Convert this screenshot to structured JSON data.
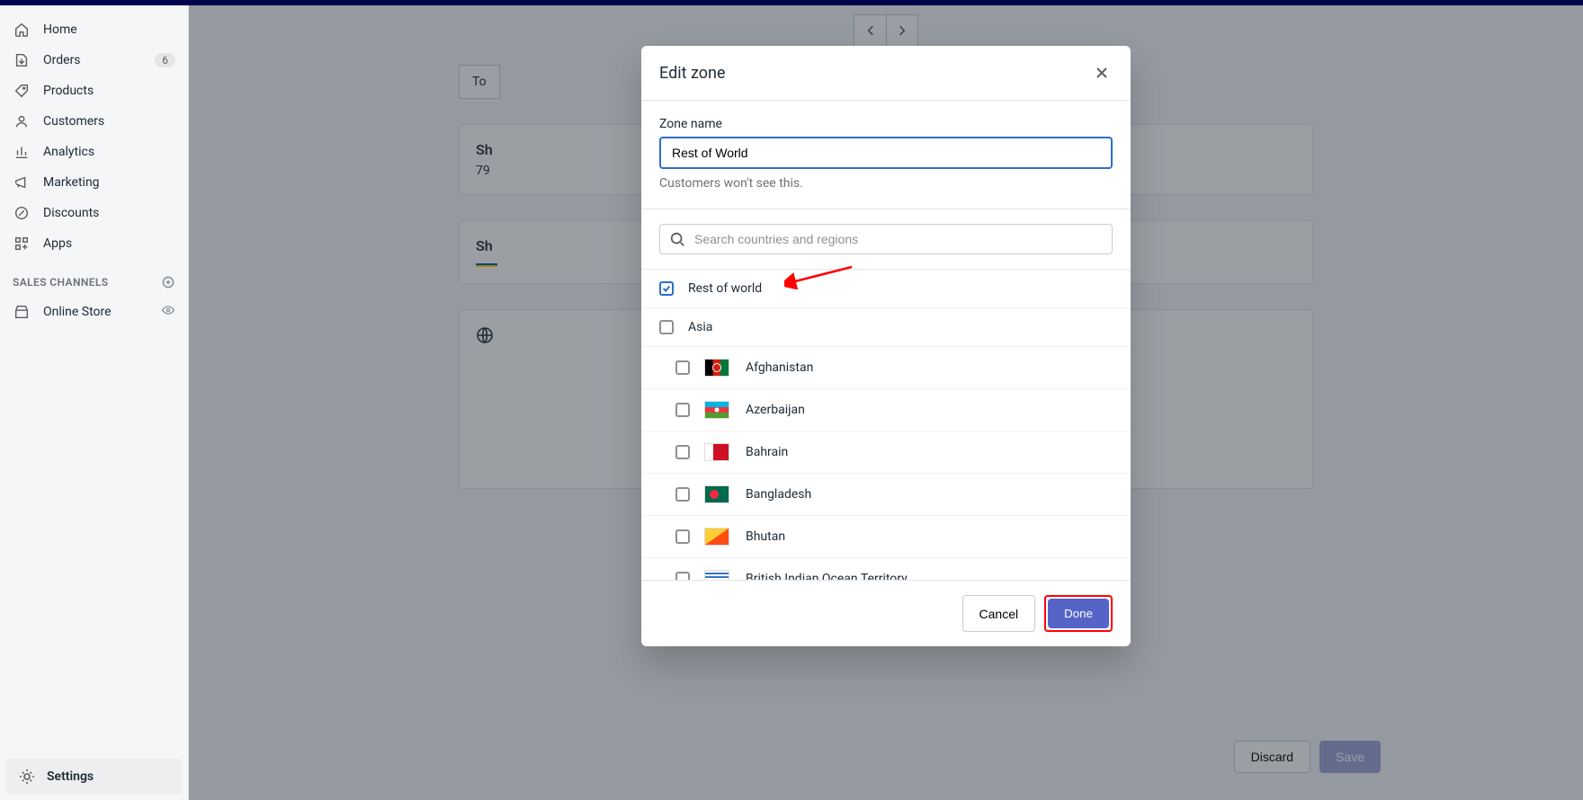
{
  "sidebar": {
    "items": [
      {
        "label": "Home"
      },
      {
        "label": "Orders",
        "badge": "6"
      },
      {
        "label": "Products"
      },
      {
        "label": "Customers"
      },
      {
        "label": "Analytics"
      },
      {
        "label": "Marketing"
      },
      {
        "label": "Discounts"
      },
      {
        "label": "Apps"
      }
    ],
    "sales_channels_label": "SALES CHANNELS",
    "online_store_label": "Online Store",
    "settings_label": "Settings"
  },
  "background": {
    "tab_prefix": "To",
    "card1_prefix": "Sh",
    "card1_sub": "79",
    "card2_prefix": "Sh"
  },
  "footer": {
    "discard_label": "Discard",
    "save_label": "Save"
  },
  "modal": {
    "title": "Edit zone",
    "zone_name_label": "Zone name",
    "zone_name_value": "Rest of World",
    "help_text": "Customers won't see this.",
    "search_placeholder": "Search countries and regions",
    "rest_of_world_label": "Rest of world",
    "asia_label": "Asia",
    "countries": [
      {
        "name": "Afghanistan",
        "flag": "flag-af"
      },
      {
        "name": "Azerbaijan",
        "flag": "flag-az"
      },
      {
        "name": "Bahrain",
        "flag": "flag-bh"
      },
      {
        "name": "Bangladesh",
        "flag": "flag-bd"
      },
      {
        "name": "Bhutan",
        "flag": "flag-bt"
      },
      {
        "name": "British Indian Ocean Territory",
        "flag": "flag-io"
      }
    ],
    "cancel_label": "Cancel",
    "done_label": "Done"
  }
}
